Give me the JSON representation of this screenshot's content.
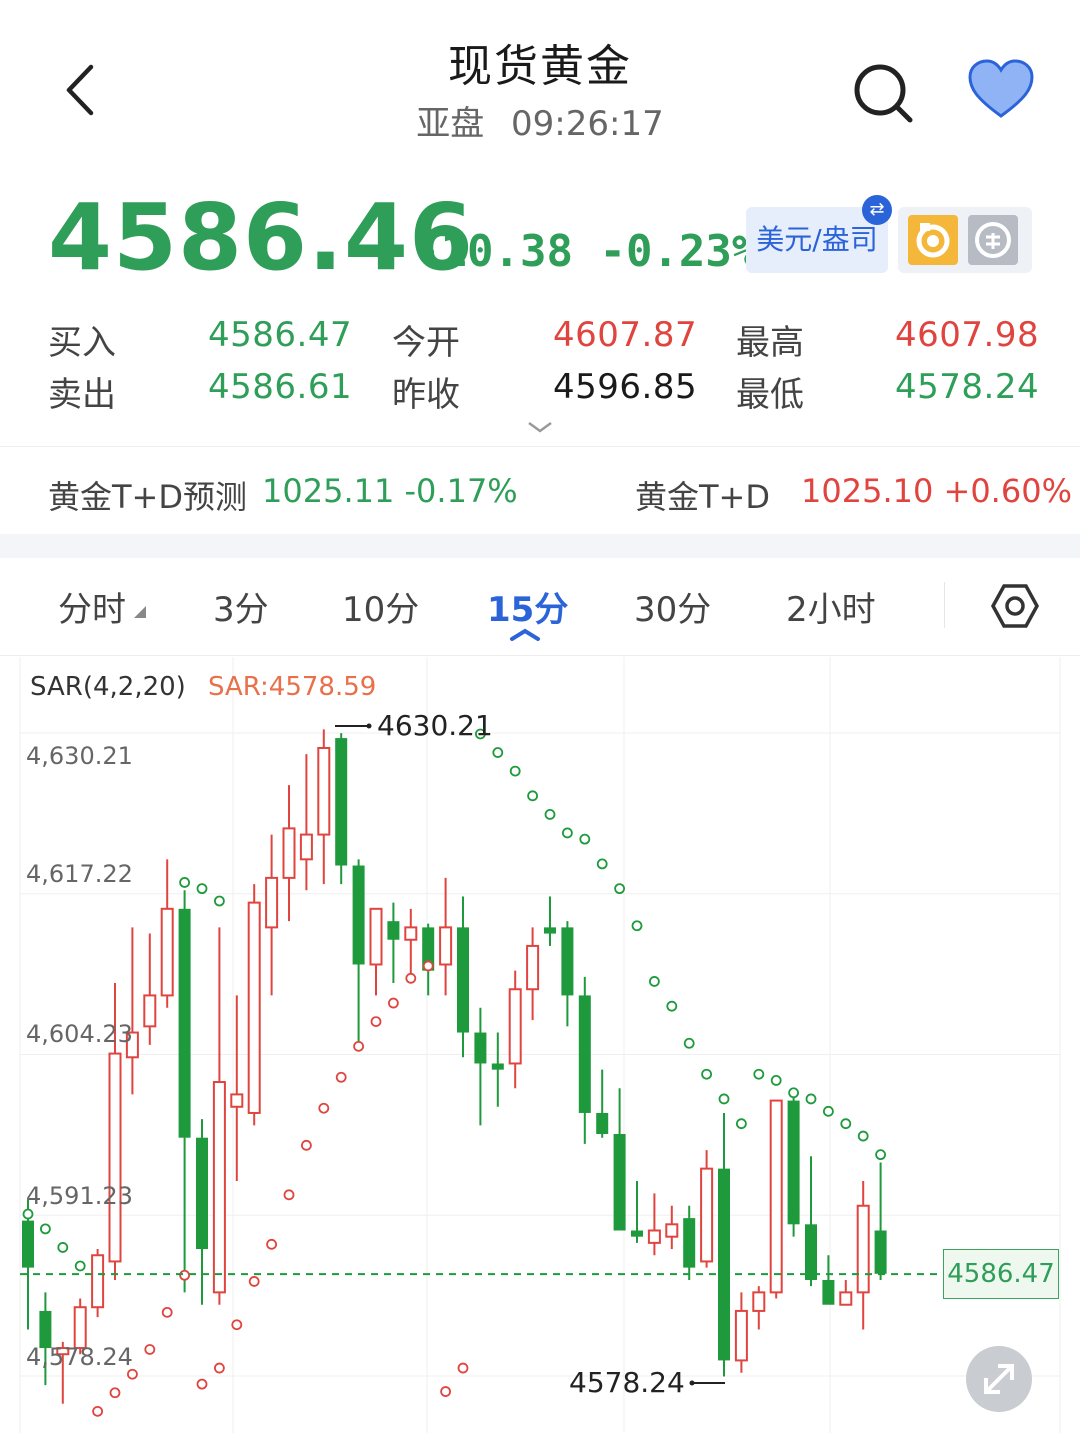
{
  "header": {
    "title": "现货黄金",
    "market": "亚盘",
    "time": "09:26:17"
  },
  "price": {
    "current": "4586.46",
    "change": "-10.38",
    "change_pct": "-0.23%",
    "currency_button": "美元/盎司",
    "currency_badge": "⇄"
  },
  "quote": {
    "buy_label": "买入",
    "buy": "4586.47",
    "sell_label": "卖出",
    "sell": "4586.61",
    "open_label": "今开",
    "open": "4607.87",
    "prev_close_label": "昨收",
    "prev_close": "4596.85",
    "high_label": "最高",
    "high": "4607.98",
    "low_label": "最低",
    "low": "4578.24"
  },
  "tickers": {
    "forecast_label": "黄金T+D预测",
    "forecast_value": "1025.11 -0.17%",
    "td_label": "黄金T+D",
    "td_value": "1025.10 +0.60%"
  },
  "tabs": [
    {
      "label": "分时"
    },
    {
      "label": "3分"
    },
    {
      "label": "10分"
    },
    {
      "label": "15分"
    },
    {
      "label": "30分"
    },
    {
      "label": "2小时"
    }
  ],
  "active_tab": "15分",
  "colors": {
    "up": "#e0443f",
    "down": "#1e9a3c",
    "accent": "#2b63d9",
    "sar_below": "#e0443f",
    "sar_above": "#1e9a3c"
  },
  "chart_data": {
    "type": "candlestick",
    "indicator_label": "SAR(4,2,20)",
    "indicator_value": "SAR:4578.59",
    "y_ticks": [
      "4,630.21",
      "4,617.22",
      "4,604.23",
      "4,591.23",
      "4,578.24"
    ],
    "y_tick_values": [
      4630.21,
      4617.22,
      4604.23,
      4591.23,
      4578.24
    ],
    "high_annotation": "4630.21",
    "low_annotation": "4578.24",
    "current_line_label": "4586.47",
    "current_line_value": 4586.47,
    "candles": [
      [
        4590.8,
        4592.5,
        4582.0,
        4587.0
      ],
      [
        4583.5,
        4585.0,
        4577.5,
        4580.5
      ],
      [
        4580.0,
        4581.0,
        4576.0,
        4580.5
      ],
      [
        4580.5,
        4584.5,
        4580.0,
        4583.8
      ],
      [
        4583.8,
        4588.5,
        4583.0,
        4588.0
      ],
      [
        4587.5,
        4610.0,
        4586.0,
        4604.3
      ],
      [
        4604.0,
        4614.5,
        4601.0,
        4606.0
      ],
      [
        4606.5,
        4614.0,
        4605.0,
        4609.0
      ],
      [
        4609.0,
        4620.0,
        4608.0,
        4616.0
      ],
      [
        4616.0,
        4617.5,
        4585.0,
        4597.5
      ],
      [
        4597.5,
        4599.0,
        4584.0,
        4588.5
      ],
      [
        4585.0,
        4614.5,
        4584.0,
        4602.0
      ],
      [
        4600.0,
        4609.0,
        4594.0,
        4601.0
      ],
      [
        4599.5,
        4618.0,
        4598.5,
        4616.5
      ],
      [
        4614.5,
        4622.0,
        4609.0,
        4618.5
      ],
      [
        4618.5,
        4626.0,
        4615.0,
        4622.5
      ],
      [
        4620.0,
        4628.5,
        4617.5,
        4622.0
      ],
      [
        4622.0,
        4630.5,
        4618.0,
        4629.0
      ],
      [
        4629.8,
        4630.2,
        4618.0,
        4619.5
      ],
      [
        4619.5,
        4620.0,
        4604.5,
        4611.5
      ],
      [
        4611.5,
        4616.0,
        4609.0,
        4616.0
      ],
      [
        4615.0,
        4616.5,
        4610.0,
        4613.5
      ],
      [
        4613.5,
        4616.0,
        4610.5,
        4614.5
      ],
      [
        4614.5,
        4614.8,
        4609.0,
        4611.0
      ],
      [
        4611.5,
        4618.5,
        4609.0,
        4614.5
      ],
      [
        4614.5,
        4617.0,
        4604.0,
        4606.0
      ],
      [
        4606.0,
        4608.0,
        4598.5,
        4603.5
      ],
      [
        4603.5,
        4606.0,
        4600.0,
        4603.0
      ],
      [
        4603.5,
        4611.0,
        4601.5,
        4609.5
      ],
      [
        4609.5,
        4614.5,
        4607.0,
        4613.0
      ],
      [
        4614.5,
        4617.0,
        4613.0,
        4614.0
      ],
      [
        4614.5,
        4615.0,
        4606.5,
        4609.0
      ],
      [
        4609.0,
        4610.5,
        4597.0,
        4599.5
      ],
      [
        4599.5,
        4603.0,
        4597.5,
        4597.8
      ],
      [
        4597.8,
        4601.5,
        4591.0,
        4590.0
      ],
      [
        4590.0,
        4594.0,
        4589.0,
        4589.5
      ],
      [
        4589.0,
        4593.0,
        4588.0,
        4590.0
      ],
      [
        4589.5,
        4592.0,
        4588.5,
        4590.5
      ],
      [
        4591.0,
        4592.0,
        4586.0,
        4587.0
      ],
      [
        4587.5,
        4596.5,
        4587.0,
        4595.0
      ],
      [
        4595.0,
        4599.5,
        4578.2,
        4579.5
      ],
      [
        4579.5,
        4585.0,
        4578.5,
        4583.5
      ],
      [
        4583.5,
        4585.5,
        4582.0,
        4585.0
      ],
      [
        4585.0,
        4600.5,
        4584.5,
        4600.5
      ],
      [
        4600.5,
        4601.0,
        4589.5,
        4590.5
      ],
      [
        4590.5,
        4596.0,
        4585.5,
        4586.0
      ],
      [
        4586.0,
        4588.0,
        4584.5,
        4584.0
      ],
      [
        4584.0,
        4586.0,
        4584.0,
        4585.0
      ],
      [
        4585.0,
        4594.0,
        4582.0,
        4592.0
      ],
      [
        4590.0,
        4595.5,
        4586.0,
        4586.5
      ]
    ],
    "sar_below": [
      {
        "i": 4,
        "v": 4577.0
      },
      {
        "i": 5,
        "v": 4578.5
      },
      {
        "i": 6,
        "v": 4580.0
      },
      {
        "i": 7,
        "v": 4582.0
      },
      {
        "i": 8,
        "v": 4585.0
      },
      {
        "i": 9,
        "v": 4588.0
      },
      {
        "i": 10,
        "v": 4579.2
      },
      {
        "i": 11,
        "v": 4580.5
      },
      {
        "i": 12,
        "v": 4584.0
      },
      {
        "i": 13,
        "v": 4587.5
      },
      {
        "i": 14,
        "v": 4590.5
      },
      {
        "i": 15,
        "v": 4594.5
      },
      {
        "i": 16,
        "v": 4598.5
      },
      {
        "i": 17,
        "v": 4601.5
      },
      {
        "i": 18,
        "v": 4604.0
      },
      {
        "i": 19,
        "v": 4606.5
      },
      {
        "i": 20,
        "v": 4608.5
      },
      {
        "i": 21,
        "v": 4610.0
      },
      {
        "i": 22,
        "v": 4612.0
      },
      {
        "i": 23,
        "v": 4613.0
      },
      {
        "i": 24,
        "v": 4578.6
      },
      {
        "i": 25,
        "v": 4580.5
      }
    ],
    "sar_above": [
      {
        "i": 0,
        "v": 4590.2
      },
      {
        "i": 1,
        "v": 4589.0
      },
      {
        "i": 2,
        "v": 4587.5
      },
      {
        "i": 3,
        "v": 4586.0
      },
      {
        "i": 9,
        "v": 4617.0
      },
      {
        "i": 10,
        "v": 4616.5
      },
      {
        "i": 11,
        "v": 4615.5
      },
      {
        "i": 26,
        "v": 4629.0
      },
      {
        "i": 27,
        "v": 4627.5
      },
      {
        "i": 28,
        "v": 4626.0
      },
      {
        "i": 29,
        "v": 4624.0
      },
      {
        "i": 30,
        "v": 4622.5
      },
      {
        "i": 31,
        "v": 4621.0
      },
      {
        "i": 32,
        "v": 4620.5
      },
      {
        "i": 33,
        "v": 4618.5
      },
      {
        "i": 34,
        "v": 4616.5
      },
      {
        "i": 35,
        "v": 4613.5
      },
      {
        "i": 36,
        "v": 4609.0
      },
      {
        "i": 37,
        "v": 4607.0
      },
      {
        "i": 38,
        "v": 4604.0
      },
      {
        "i": 39,
        "v": 4601.5
      },
      {
        "i": 40,
        "v": 4599.5
      },
      {
        "i": 41,
        "v": 4597.5
      },
      {
        "i": 42,
        "v": 4601.5
      },
      {
        "i": 43,
        "v": 4601.0
      },
      {
        "i": 44,
        "v": 4600.0
      },
      {
        "i": 45,
        "v": 4599.5
      },
      {
        "i": 46,
        "v": 4598.5
      },
      {
        "i": 47,
        "v": 4597.5
      },
      {
        "i": 48,
        "v": 4596.5
      },
      {
        "i": 49,
        "v": 4595.0
      }
    ]
  }
}
